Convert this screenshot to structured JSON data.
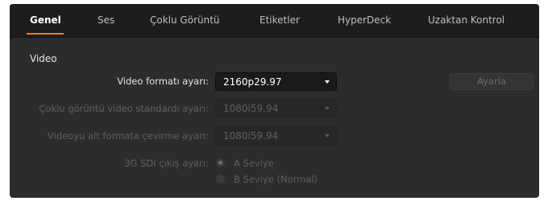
{
  "tabs": [
    {
      "label": "Genel",
      "active": true
    },
    {
      "label": "Ses",
      "active": false
    },
    {
      "label": "Çoklu Görüntü",
      "active": false
    },
    {
      "label": "Etiketler",
      "active": false
    },
    {
      "label": "HyperDeck",
      "active": false
    },
    {
      "label": "Uzaktan Kontrol",
      "active": false
    }
  ],
  "accent_color": "#e8802a",
  "video": {
    "section_title": "Video",
    "format": {
      "label": "Video formatı ayarı:",
      "value": "2160p29.97",
      "enabled": true
    },
    "multiview": {
      "label": "Çoklu görüntü video standardı ayarı:",
      "value": "1080i59.94",
      "enabled": false
    },
    "downconvert": {
      "label": "Videoyu alt formata çevirme ayarı:",
      "value": "1080i59.94",
      "enabled": false
    },
    "apply_button": "Ayarla",
    "sdi": {
      "label": "3G SDI çıkış ayarı:",
      "options": [
        {
          "label": "A Seviye",
          "checked": true
        },
        {
          "label": "B Seviye (Normal)",
          "checked": false
        }
      ]
    }
  }
}
